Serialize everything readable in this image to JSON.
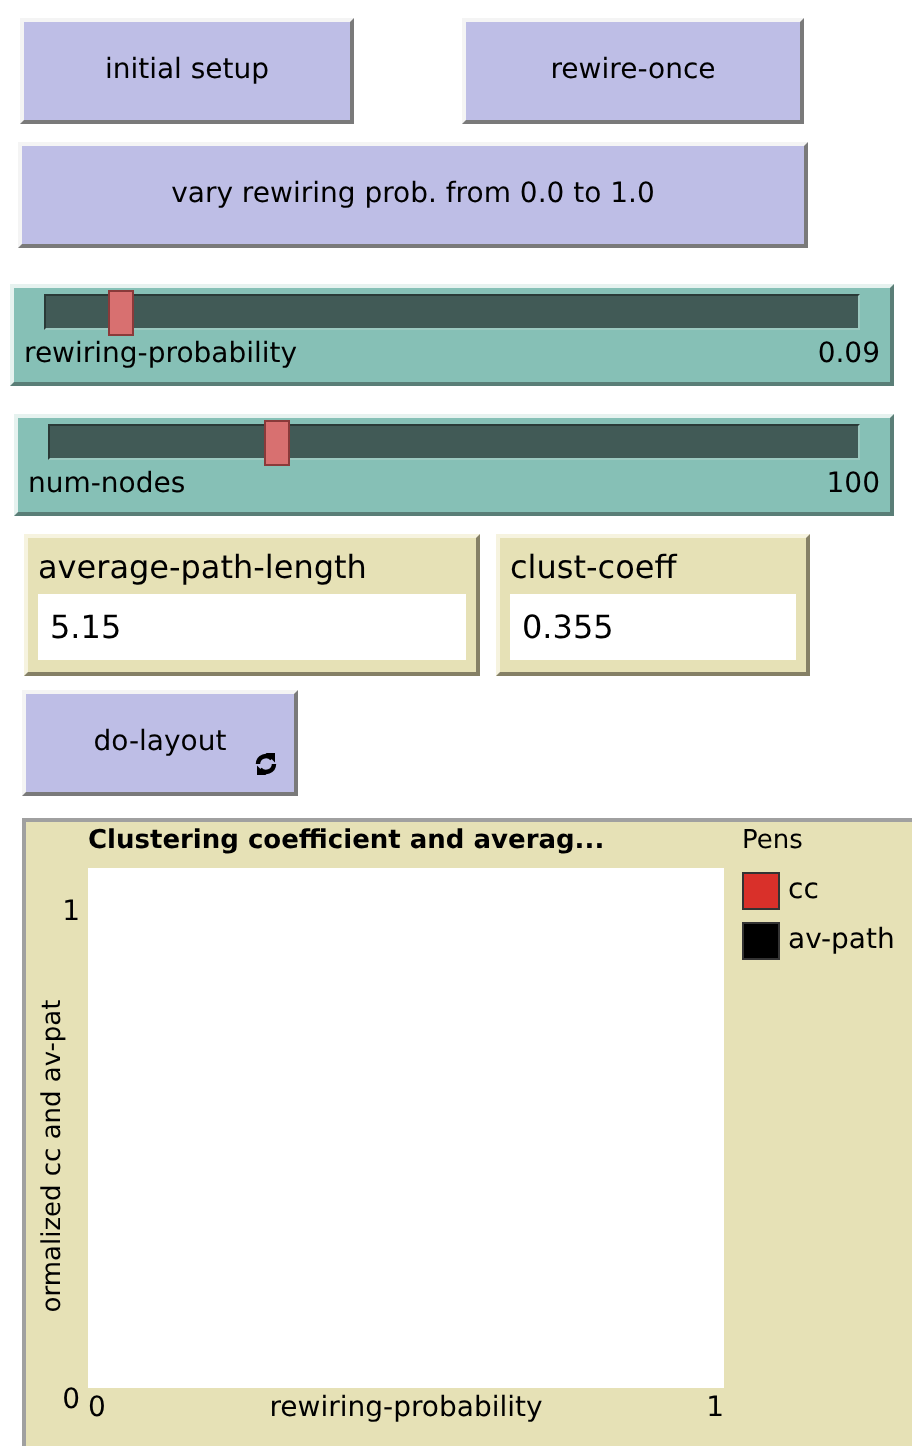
{
  "buttons": [
    {
      "label": "initial setup",
      "forever": false
    },
    {
      "label": "rewire-once",
      "forever": false
    }
  ],
  "wide_button": {
    "label": "vary rewiring prob. from 0.0 to 1.0",
    "forever": false
  },
  "sliders": [
    {
      "label": "rewiring-probability",
      "reading": "0.09",
      "level": 0.09
    },
    {
      "label": "num-nodes",
      "reading": "100",
      "level": 0.28
    }
  ],
  "monitors": [
    {
      "label": "average-path-length",
      "value": "5.15"
    },
    {
      "label": "clust-coeff",
      "value": "0.355"
    }
  ],
  "layout_button": {
    "label": "do-layout",
    "forever": true
  },
  "plot": {
    "title": "Clustering coefficient and averag...",
    "ylabel": "ormalized cc and av-pat",
    "y_max": "1",
    "y_min": "0",
    "x_min": "0",
    "xlabel": "rewiring-probability",
    "x_max": "1",
    "pens_label": "Pens",
    "pens": [
      {
        "name": "cc",
        "color": "#d9302a"
      },
      {
        "name": "av-path",
        "color": "#000000"
      }
    ]
  }
}
